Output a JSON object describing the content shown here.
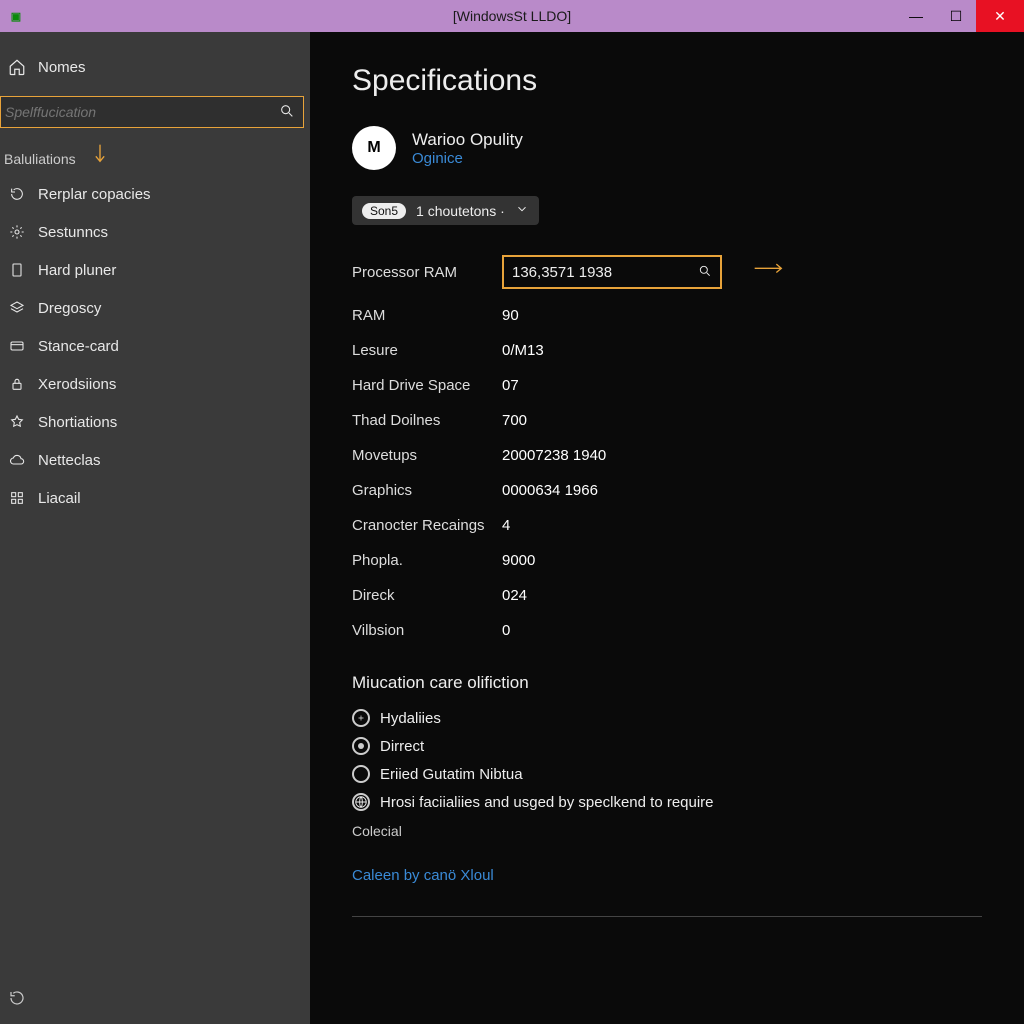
{
  "window": {
    "title": "[WindowsSt LLDO]"
  },
  "sidebar": {
    "home": "Nomes",
    "search_placeholder": "Spelffucication",
    "sublabel": "Baluliations",
    "items": [
      {
        "label": "Rerplar copacies"
      },
      {
        "label": "Sestunncs"
      },
      {
        "label": "Hard pluner"
      },
      {
        "label": "Dregoscy"
      },
      {
        "label": "Stance-card"
      },
      {
        "label": "Xerodsiions"
      },
      {
        "label": "Shortiations"
      },
      {
        "label": "Netteclas"
      },
      {
        "label": "Liacail"
      }
    ]
  },
  "main": {
    "heading": "Specifications",
    "avatar_letter": "M",
    "profile_name": "Warioo Opulity",
    "profile_link": "Oginice",
    "sort_pill": "Son5",
    "sort_label": "1 choutetons ·",
    "spec_field_value": "136,3571 1938",
    "specs": [
      {
        "label": "Processor RAM",
        "value": "136,3571 1938",
        "field": true
      },
      {
        "label": "RAM",
        "value": "90"
      },
      {
        "label": "Lesure",
        "value": "0/M13"
      },
      {
        "label": "Hard Drive Space",
        "value": "07"
      },
      {
        "label": "Thad Doilnes",
        "value": "700"
      },
      {
        "label": "Movetups",
        "value": "20007238 1940"
      },
      {
        "label": "Graphics",
        "value": "0000634 1966"
      },
      {
        "label": "Cranocter Recaings",
        "value": "4"
      },
      {
        "label": "Phopla.",
        "value": "9000"
      },
      {
        "label": "Direck",
        "value": "024"
      },
      {
        "label": "Vilbsion",
        "value": "0"
      }
    ],
    "section_sub": "Miucation care olifiction",
    "radios": [
      {
        "label": "Hydaliies"
      },
      {
        "label": "Dirrect"
      },
      {
        "label": "Eriied Gutatim Nibtua"
      },
      {
        "label": "Hrosi faciialiies and usged by speclkend to require"
      }
    ],
    "radio_trail": "Colecial",
    "bottom_link": "Caleen by canö Xloul"
  }
}
